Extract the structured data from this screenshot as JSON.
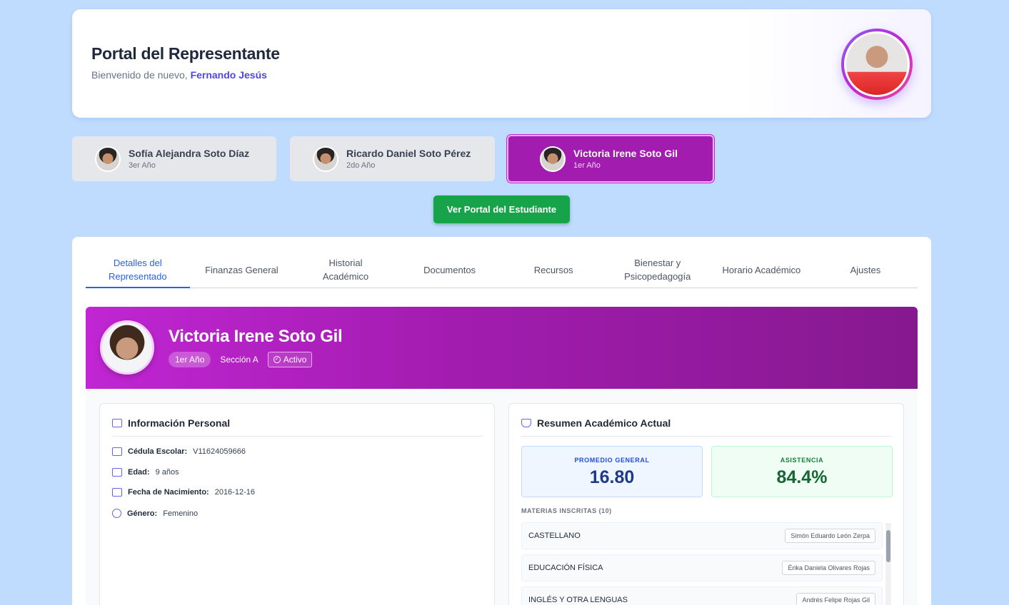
{
  "header": {
    "title": "Portal del Representante",
    "welcome": "Bienvenido de nuevo,",
    "user_name": "Fernando Jesús"
  },
  "students": [
    {
      "name": "Sofía Alejandra Soto Díaz",
      "grade": "3er Año",
      "active": false
    },
    {
      "name": "Ricardo Daniel Soto Pérez",
      "grade": "2do Año",
      "active": false
    },
    {
      "name": "Victoria Irene Soto Gil",
      "grade": "1er Año",
      "active": true
    }
  ],
  "portal_button": "Ver Portal del Estudiante",
  "tabs": [
    {
      "label": "Detalles del Representado",
      "active": true
    },
    {
      "label": "Finanzas General",
      "active": false
    },
    {
      "label": "Historial Académico",
      "active": false
    },
    {
      "label": "Documentos",
      "active": false
    },
    {
      "label": "Recursos",
      "active": false
    },
    {
      "label": "Bienestar y Psicopedagogía",
      "active": false
    },
    {
      "label": "Horario Académico",
      "active": false
    },
    {
      "label": "Ajustes",
      "active": false
    }
  ],
  "profile": {
    "name": "Victoria Irene Soto Gil",
    "grade": "1er Año",
    "section": "Sección A",
    "status": "Activo"
  },
  "personal_info": {
    "title": "Información Personal",
    "rows": [
      {
        "label": "Cédula Escolar:",
        "value": "V11624059666",
        "icon": "id-card-icon"
      },
      {
        "label": "Edad:",
        "value": "9 años",
        "icon": "calendar-icon"
      },
      {
        "label": "Fecha de Nacimiento:",
        "value": "2016-12-16",
        "icon": "calendar-icon"
      },
      {
        "label": "Género:",
        "value": "Femenino",
        "icon": "user-circle-icon"
      }
    ]
  },
  "academic": {
    "title": "Resumen Académico Actual",
    "average_label": "PROMEDIO GENERAL",
    "average_value": "16.80",
    "attendance_label": "ASISTENCIA",
    "attendance_value": "84.4%",
    "subjects_title": "MATERIAS INSCRITAS (10)",
    "subjects": [
      {
        "name": "CASTELLANO",
        "teacher": "Simón Eduardo León Zerpa"
      },
      {
        "name": "EDUCACIÓN FÍSICA",
        "teacher": "Érika Daniela Olivares Rojas"
      },
      {
        "name": "INGLÉS Y OTRA LENGUAS",
        "teacher": "Andrés Felipe Rojas Gil"
      }
    ]
  },
  "colors": {
    "background": "#bfdbfe",
    "accent_purple": "#a21caf",
    "button_green": "#16a34a",
    "tab_active": "#2563eb"
  }
}
